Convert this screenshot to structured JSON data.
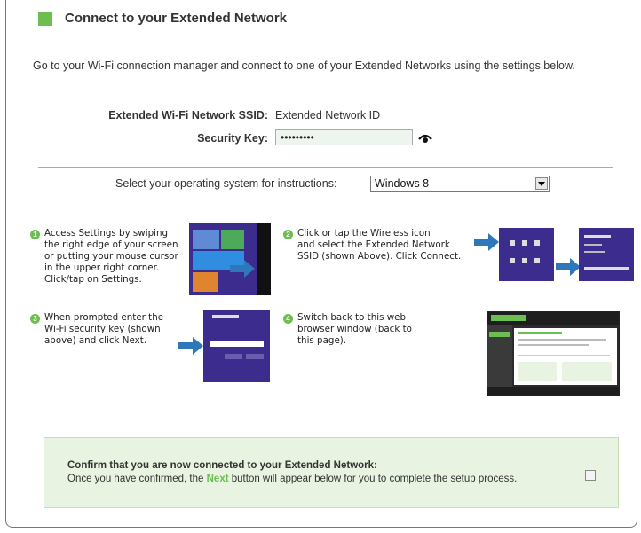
{
  "header": {
    "title": "Connect to your Extended Network"
  },
  "intro": "Go to your Wi-Fi connection manager and connect to one of your Extended Networks using the settings below.",
  "network": {
    "ssid_label": "Extended Wi-Fi Network SSID:",
    "ssid_value": "Extended Network ID",
    "key_label": "Security Key:",
    "key_value": "•••••••••"
  },
  "os_select": {
    "label": "Select your operating system for instructions:",
    "selected": "Windows 8"
  },
  "steps": [
    {
      "num": "1",
      "lines": [
        "Access Settings by swiping",
        "the right edge of your screen",
        "or putting your mouse cursor",
        "in the upper right corner.",
        "Click/tap on Settings."
      ]
    },
    {
      "num": "2",
      "lines": [
        "Click or tap the Wireless icon",
        "and select the Extended Network",
        "SSID (shown Above). Click Connect."
      ]
    },
    {
      "num": "3",
      "lines": [
        "When prompted enter the",
        "Wi-Fi security key (shown",
        "above) and click Next."
      ]
    },
    {
      "num": "4",
      "lines": [
        "Switch back to this web",
        "browser window (back to",
        "this page)."
      ]
    }
  ],
  "confirm": {
    "title": "Confirm that you are now connected to your Extended Network:",
    "text_before": "Once you have confirmed, the ",
    "next_word": "Next",
    "text_after": " button will appear below for you to complete the setup process.",
    "checked": false
  },
  "colors": {
    "accent_green": "#6cbf4f",
    "confirm_bg": "#e9f3e1",
    "win8_purple": "#3b2c8d",
    "arrow_blue": "#2e77bb"
  },
  "icons": [
    "eye-icon",
    "arrow-right-icon",
    "checkbox-icon",
    "dropdown-arrow-icon"
  ]
}
